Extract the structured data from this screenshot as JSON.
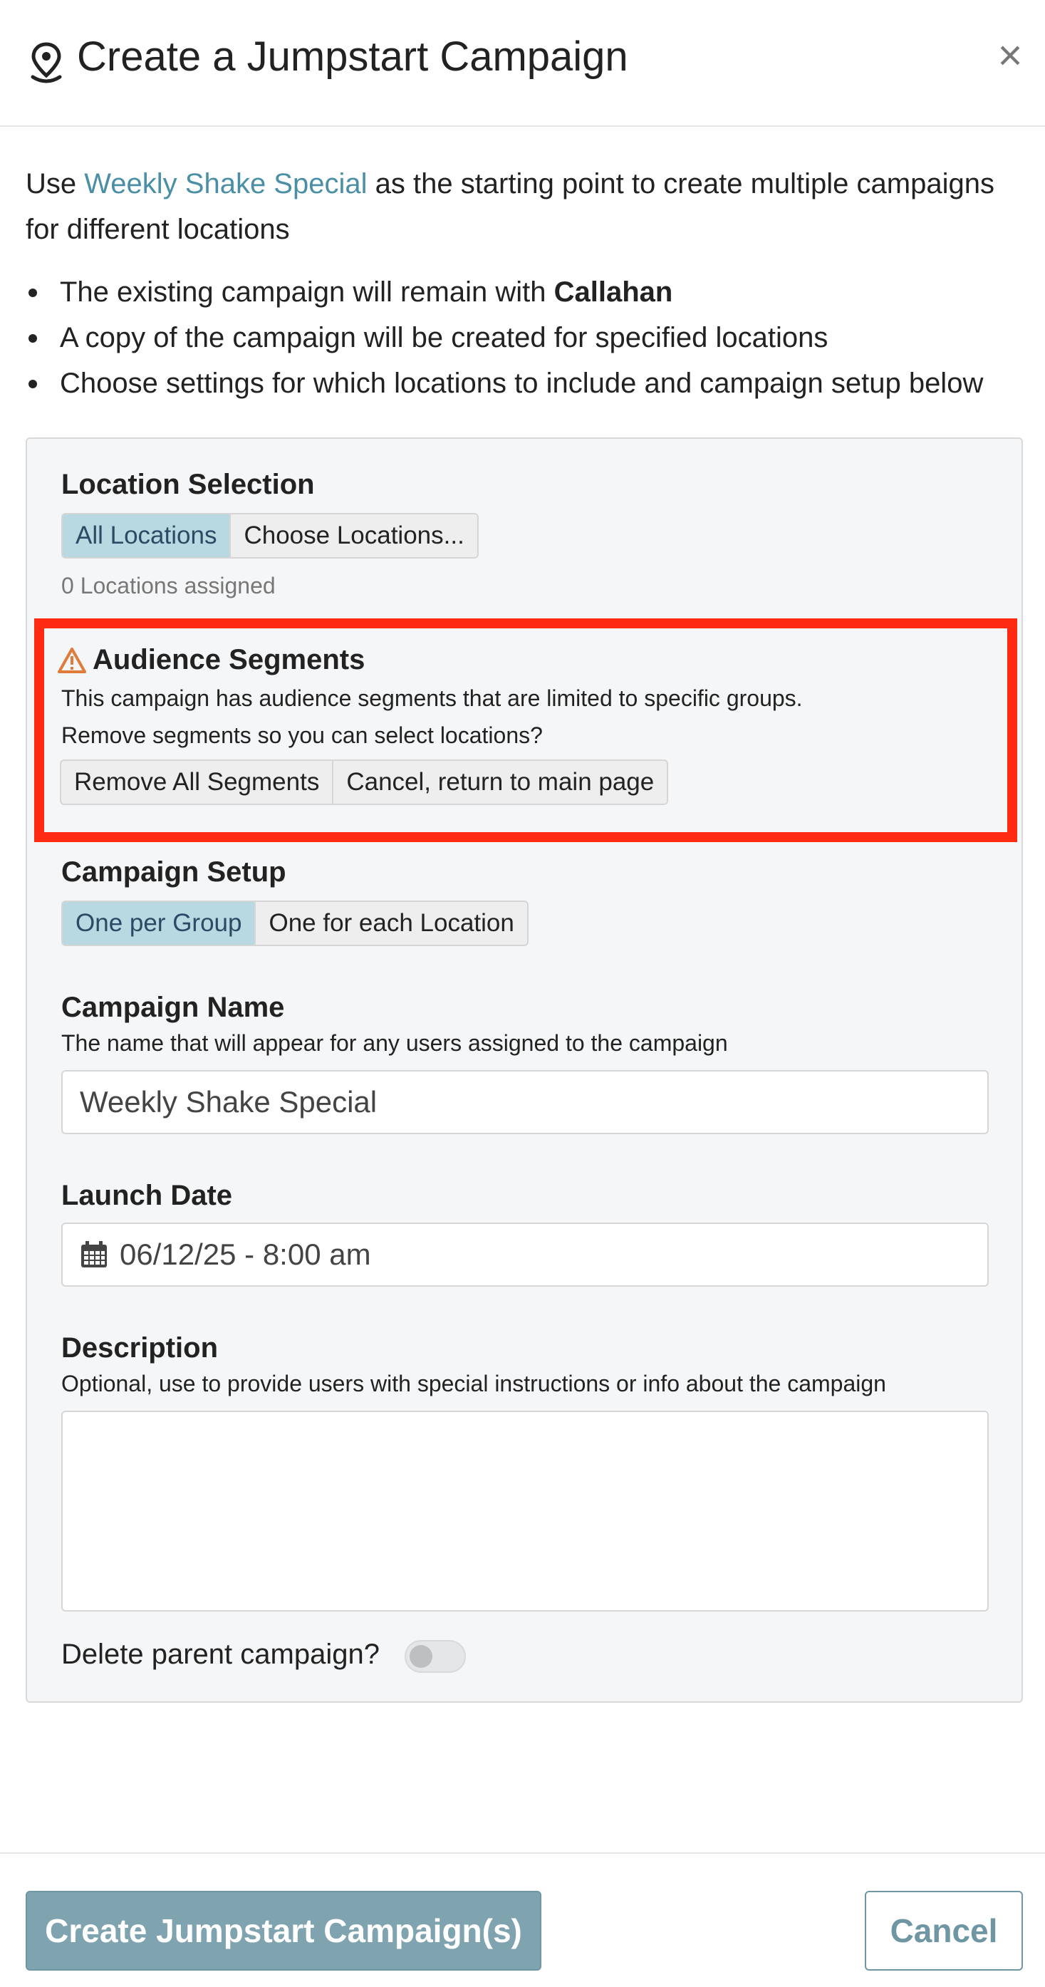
{
  "header": {
    "title": "Create a Jumpstart Campaign",
    "close_glyph": "×",
    "icon": "map-pin-icon"
  },
  "intro": {
    "prefix": "Use ",
    "campaign_link": "Weekly Shake Special",
    "suffix": " as the starting point to create multiple campaigns for different locations"
  },
  "bullets": {
    "item1_text": "The existing campaign will remain with ",
    "item1_bold": "Callahan",
    "item2": "A copy of the campaign will be created for specified locations",
    "item3": "Choose settings for which locations to include and campaign setup below"
  },
  "location_selection": {
    "label": "Location Selection",
    "options": [
      "All Locations",
      "Choose Locations..."
    ],
    "selected": "All Locations",
    "assigned_text": "0 Locations assigned"
  },
  "audience_segments": {
    "icon": "warning-icon",
    "title": "Audience Segments",
    "line1": "This campaign has audience segments that are limited to specific groups.",
    "line2": "Remove segments so you can select locations?",
    "buttons": [
      "Remove All Segments",
      "Cancel, return to main page"
    ]
  },
  "campaign_setup": {
    "label": "Campaign Setup",
    "options": [
      "One per Group",
      "One for each Location"
    ],
    "selected": "One per Group"
  },
  "campaign_name": {
    "label": "Campaign Name",
    "help": "The name that will appear for any users assigned to the campaign",
    "value": "Weekly Shake Special"
  },
  "launch_date": {
    "label": "Launch Date",
    "icon": "calendar-icon",
    "value": "06/12/25 - 8:00 am"
  },
  "description": {
    "label": "Description",
    "help": "Optional, use to provide users with special instructions or info about the campaign",
    "value": ""
  },
  "delete_parent": {
    "label": "Delete parent campaign?",
    "enabled": false
  },
  "footer": {
    "create_label": "Create Jumpstart Campaign(s)",
    "cancel_label": "Cancel"
  },
  "colors": {
    "link": "#4a8fa6",
    "active_segment": "#b8d8e2",
    "highlight_border": "#ff2a12",
    "primary_button": "#7fa4b0",
    "warning": "#e07b39"
  }
}
